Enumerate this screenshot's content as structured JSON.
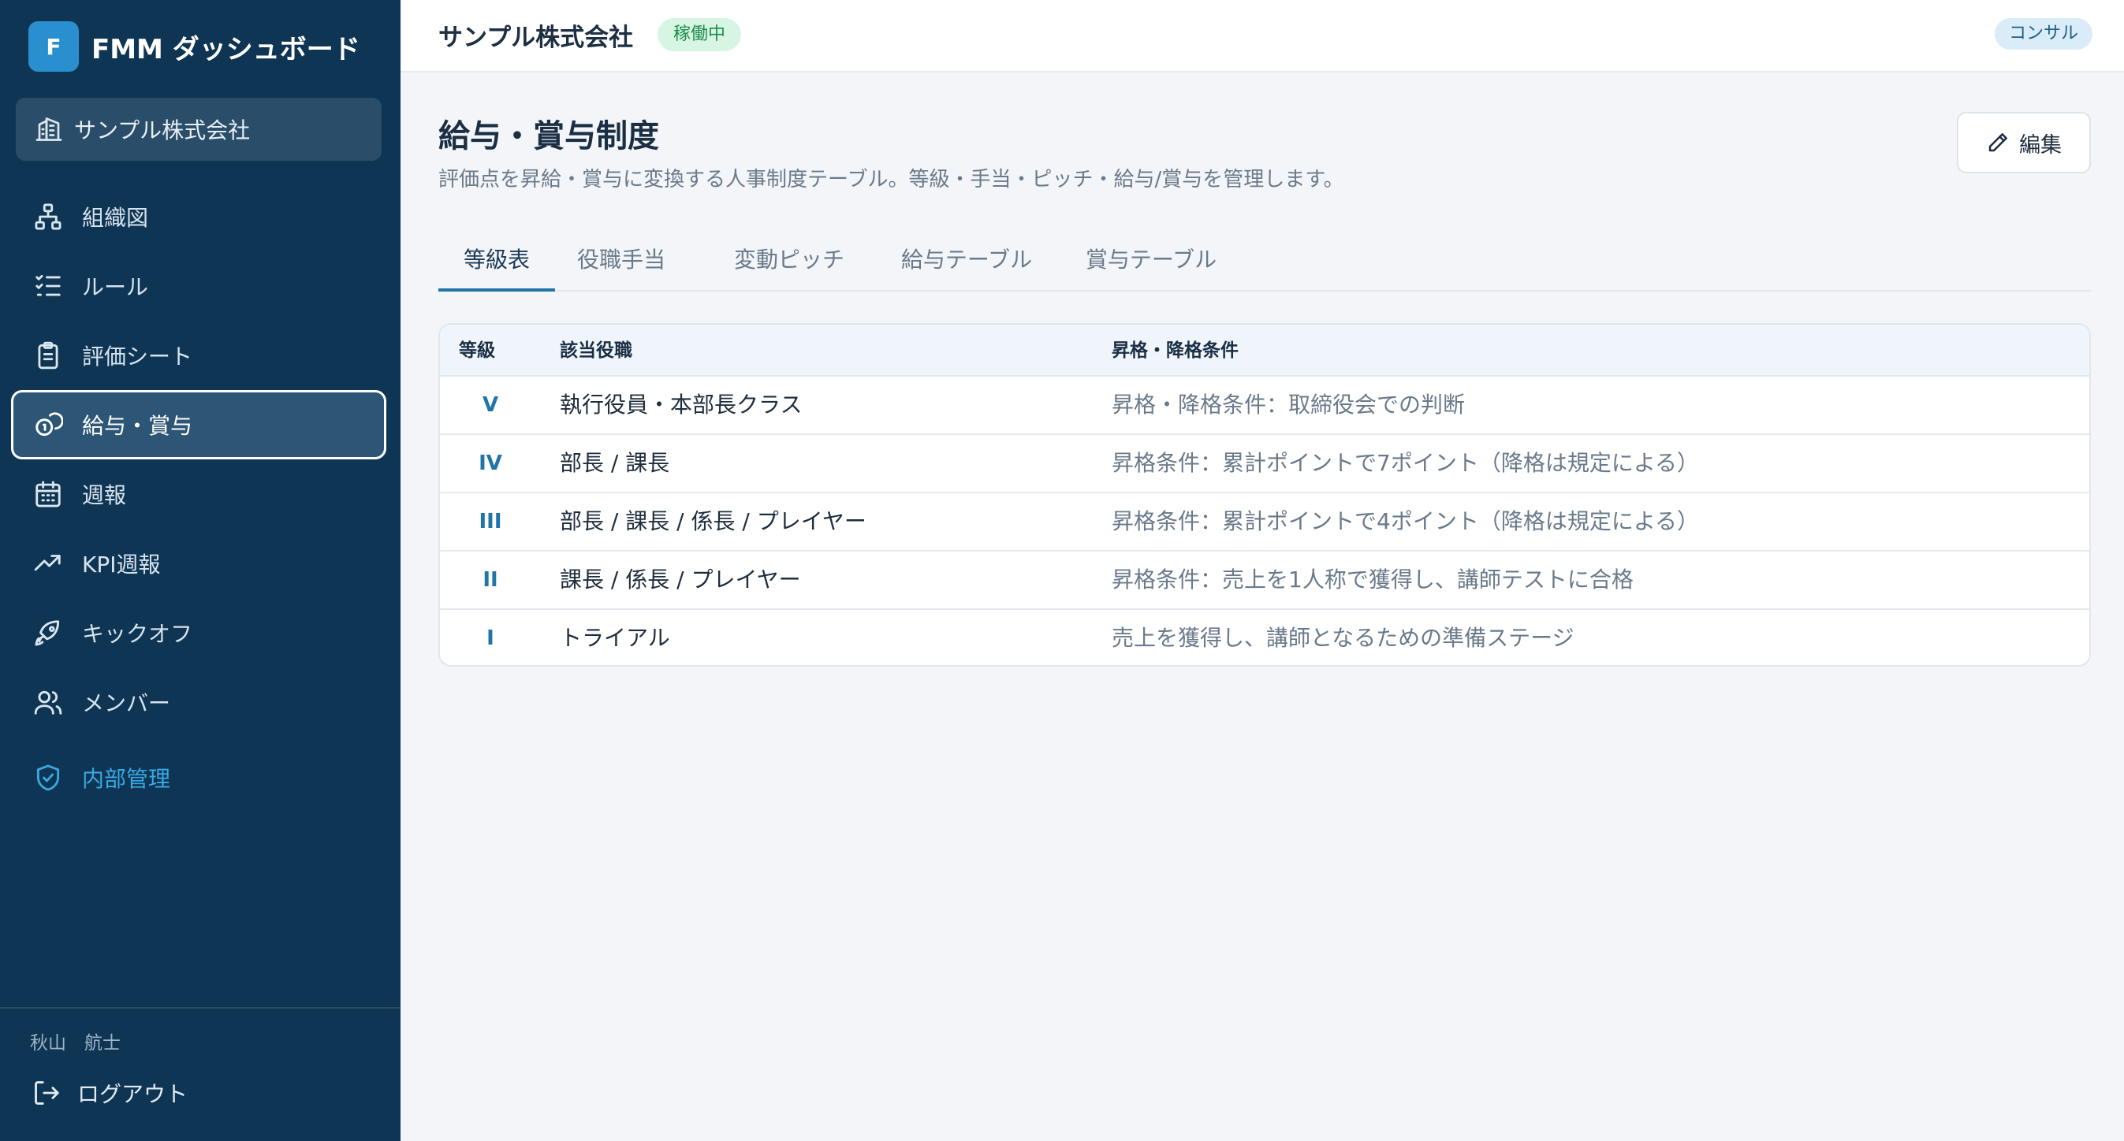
{
  "app": {
    "logo_letter": "F",
    "title": "FMM ダッシュボード"
  },
  "sidebar": {
    "company": "サンプル株式会社",
    "items": [
      {
        "label": "組織図",
        "icon": "org-chart-icon"
      },
      {
        "label": "ルール",
        "icon": "checklist-icon"
      },
      {
        "label": "評価シート",
        "icon": "clipboard-icon"
      },
      {
        "label": "給与・賞与",
        "icon": "coins-icon",
        "active": true
      },
      {
        "label": "週報",
        "icon": "calendar-icon"
      },
      {
        "label": "KPI週報",
        "icon": "trending-up-icon"
      },
      {
        "label": "キックオフ",
        "icon": "rocket-icon"
      },
      {
        "label": "メンバー",
        "icon": "users-icon"
      },
      {
        "label": "内部管理",
        "icon": "shield-check-icon",
        "accent": true
      }
    ],
    "user_name": "秋山　航士",
    "logout_label": "ログアウト"
  },
  "topbar": {
    "company": "サンプル株式会社",
    "status": "稼働中",
    "role": "コンサル"
  },
  "page": {
    "title": "給与・賞与制度",
    "description": "評価点を昇給・賞与に変換する人事制度テーブル。等級・手当・ピッチ・給与/賞与を管理します。",
    "edit_label": "編集"
  },
  "tabs": [
    "等級表",
    "役職手当",
    "変動ピッチ",
    "給与テーブル",
    "賞与テーブル"
  ],
  "table": {
    "headers": [
      "等級",
      "該当役職",
      "昇格・降格条件"
    ],
    "rows": [
      {
        "grade": "V",
        "role": "執行役員・本部長クラス",
        "condition": "昇格・降格条件：取締役会での判断"
      },
      {
        "grade": "IV",
        "role": "部長 / 課長",
        "condition": "昇格条件：累計ポイントで7ポイント（降格は規定による）"
      },
      {
        "grade": "III",
        "role": "部長 / 課長 / 係長 / プレイヤー",
        "condition": "昇格条件：累計ポイントで4ポイント（降格は規定による）"
      },
      {
        "grade": "II",
        "role": "課長 / 係長 / プレイヤー",
        "condition": "昇格条件：売上を1人称で獲得し、講師テストに合格"
      },
      {
        "grade": "I",
        "role": "トライアル",
        "condition": "売上を獲得し、講師となるための準備ステージ"
      }
    ]
  },
  "colors": {
    "sidebar_bg": "#0e3553",
    "accent": "#1f74a8",
    "status_green": "#1f8a4c"
  }
}
